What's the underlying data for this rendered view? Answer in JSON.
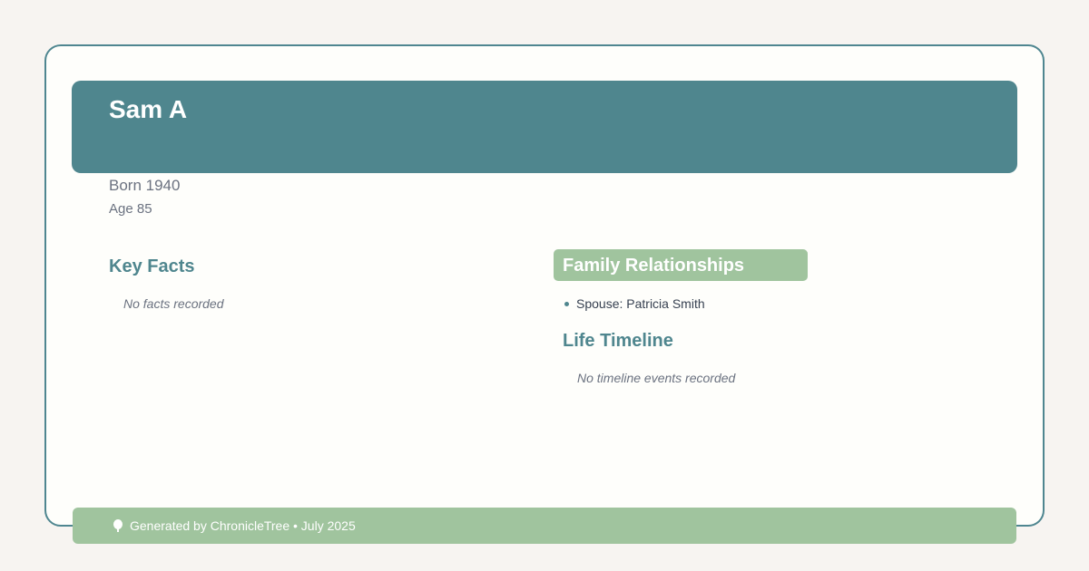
{
  "header": {
    "name": "Sam A"
  },
  "vitals": {
    "born": "Born 1940",
    "age": "Age 85"
  },
  "key_facts": {
    "title": "Key Facts",
    "empty_message": "No facts recorded"
  },
  "family": {
    "title": "Family Relationships",
    "items": [
      {
        "label": "Spouse: Patricia Smith"
      }
    ]
  },
  "timeline": {
    "title": "Life Timeline",
    "empty_message": "No timeline events recorded"
  },
  "footer": {
    "icon": "tree-icon",
    "text": "Generated by ChronicleTree • July 2025"
  },
  "colors": {
    "primary": "#4f868e",
    "accent": "#a0c49e",
    "background": "#f7f4f1",
    "card": "#fefefb"
  }
}
